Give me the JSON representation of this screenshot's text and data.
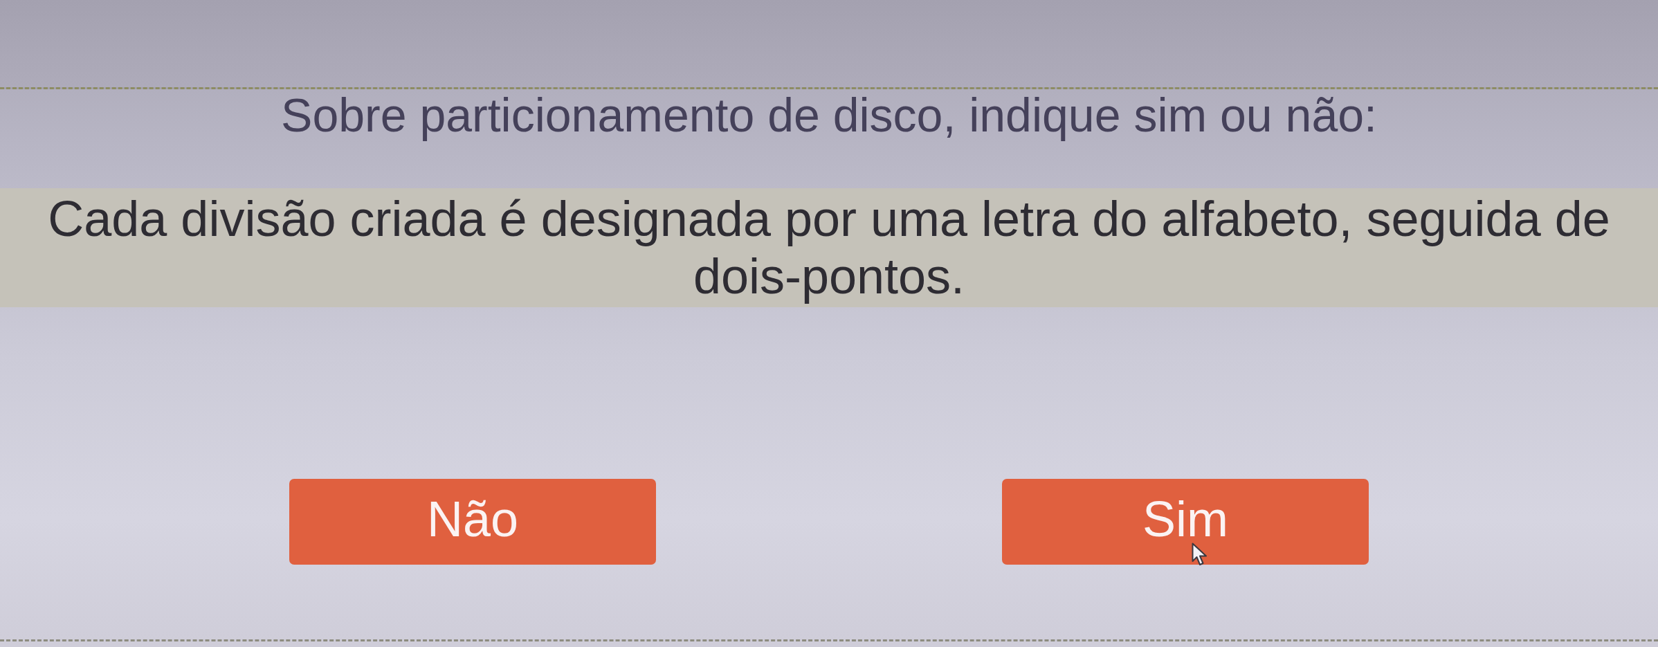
{
  "header": {
    "title": "Sobre particionamento de disco, indique sim ou não:"
  },
  "question": {
    "text": "Cada divisão criada é designada por uma letra do alfabeto, seguida de dois-pontos."
  },
  "answer_buttons": [
    {
      "label": "Não"
    },
    {
      "label": "Sim"
    }
  ]
}
